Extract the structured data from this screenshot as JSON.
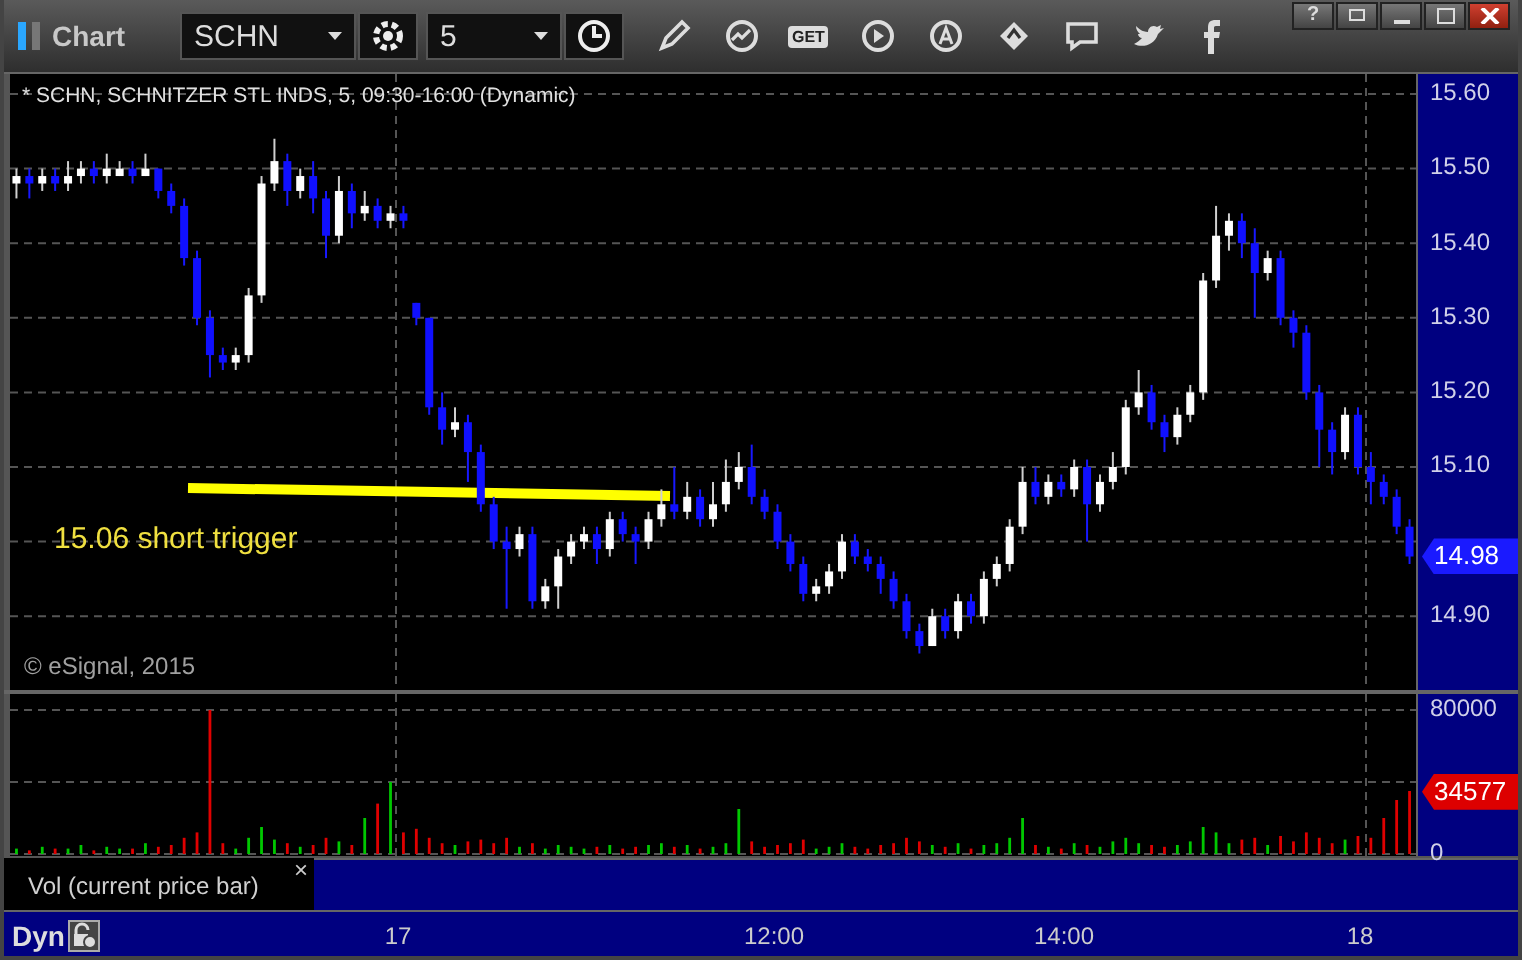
{
  "window": {
    "title": "Chart",
    "help": "?"
  },
  "toolbar": {
    "symbol": "SCHN",
    "interval": "5",
    "get_label": "GET"
  },
  "price_panel": {
    "header": "* SCHN, SCHNITZER STL INDS, 5, 09:30-16:00 (Dynamic)",
    "annotation": "15.06 short trigger",
    "copyright": "© eSignal, 2015",
    "last_price": "14.98",
    "chart_data": {
      "type": "candlestick",
      "yticks": [
        {
          "value": 15.6,
          "label": "15.60"
        },
        {
          "value": 15.5,
          "label": "15.50"
        },
        {
          "value": 15.4,
          "label": "15.40"
        },
        {
          "value": 15.3,
          "label": "15.30"
        },
        {
          "value": 15.2,
          "label": "15.20"
        },
        {
          "value": 15.1,
          "label": "15.10"
        },
        {
          "value": 14.9,
          "label": "14.90"
        }
      ],
      "ylim": [
        14.8,
        15.63
      ],
      "grid": true,
      "ohlc": [
        [
          15.48,
          15.5,
          15.46,
          15.49
        ],
        [
          15.49,
          15.5,
          15.46,
          15.48
        ],
        [
          15.48,
          15.5,
          15.47,
          15.49
        ],
        [
          15.49,
          15.5,
          15.47,
          15.48
        ],
        [
          15.48,
          15.51,
          15.47,
          15.49
        ],
        [
          15.49,
          15.51,
          15.48,
          15.5
        ],
        [
          15.5,
          15.51,
          15.48,
          15.49
        ],
        [
          15.49,
          15.52,
          15.48,
          15.5
        ],
        [
          15.49,
          15.51,
          15.49,
          15.5
        ],
        [
          15.5,
          15.51,
          15.48,
          15.49
        ],
        [
          15.49,
          15.52,
          15.49,
          15.5
        ],
        [
          15.5,
          15.5,
          15.46,
          15.47
        ],
        [
          15.47,
          15.48,
          15.44,
          15.45
        ],
        [
          15.45,
          15.46,
          15.37,
          15.38
        ],
        [
          15.38,
          15.39,
          15.29,
          15.3
        ],
        [
          15.3,
          15.31,
          15.22,
          15.25
        ],
        [
          15.25,
          15.26,
          15.23,
          15.24
        ],
        [
          15.24,
          15.26,
          15.23,
          15.25
        ],
        [
          15.25,
          15.34,
          15.24,
          15.33
        ],
        [
          15.33,
          15.49,
          15.32,
          15.48
        ],
        [
          15.48,
          15.54,
          15.47,
          15.51
        ],
        [
          15.51,
          15.52,
          15.45,
          15.47
        ],
        [
          15.47,
          15.5,
          15.46,
          15.49
        ],
        [
          15.49,
          15.51,
          15.44,
          15.46
        ],
        [
          15.46,
          15.47,
          15.38,
          15.41
        ],
        [
          15.41,
          15.49,
          15.4,
          15.47
        ],
        [
          15.47,
          15.48,
          15.42,
          15.44
        ],
        [
          15.44,
          15.47,
          15.43,
          15.45
        ],
        [
          15.45,
          15.46,
          15.42,
          15.43
        ],
        [
          15.43,
          15.45,
          15.42,
          15.44
        ],
        [
          15.44,
          15.45,
          15.42,
          15.43
        ],
        [
          15.32,
          15.32,
          15.29,
          15.3
        ],
        [
          15.3,
          15.3,
          15.17,
          15.18
        ],
        [
          15.18,
          15.2,
          15.13,
          15.15
        ],
        [
          15.15,
          15.18,
          15.14,
          15.16
        ],
        [
          15.16,
          15.17,
          15.08,
          15.12
        ],
        [
          15.12,
          15.13,
          15.04,
          15.05
        ],
        [
          15.05,
          15.06,
          14.99,
          15.0
        ],
        [
          15.0,
          15.02,
          14.91,
          14.99
        ],
        [
          14.99,
          15.02,
          14.98,
          15.01
        ],
        [
          15.01,
          15.02,
          14.91,
          14.92
        ],
        [
          14.92,
          14.95,
          14.91,
          14.94
        ],
        [
          14.94,
          14.99,
          14.91,
          14.98
        ],
        [
          14.98,
          15.01,
          14.97,
          15.0
        ],
        [
          15.0,
          15.02,
          14.99,
          15.01
        ],
        [
          15.01,
          15.02,
          14.97,
          14.99
        ],
        [
          14.99,
          15.04,
          14.98,
          15.03
        ],
        [
          15.03,
          15.04,
          15.0,
          15.01
        ],
        [
          15.01,
          15.02,
          14.97,
          15.0
        ],
        [
          15.0,
          15.04,
          14.99,
          15.03
        ],
        [
          15.03,
          15.07,
          15.02,
          15.05
        ],
        [
          15.05,
          15.1,
          15.03,
          15.04
        ],
        [
          15.04,
          15.08,
          15.03,
          15.06
        ],
        [
          15.06,
          15.07,
          15.02,
          15.03
        ],
        [
          15.03,
          15.08,
          15.02,
          15.05
        ],
        [
          15.05,
          15.11,
          15.04,
          15.08
        ],
        [
          15.08,
          15.12,
          15.07,
          15.1
        ],
        [
          15.1,
          15.13,
          15.05,
          15.06
        ],
        [
          15.06,
          15.07,
          15.03,
          15.04
        ],
        [
          15.04,
          15.05,
          14.99,
          15.0
        ],
        [
          15.0,
          15.01,
          14.96,
          14.97
        ],
        [
          14.97,
          14.98,
          14.92,
          14.93
        ],
        [
          14.93,
          14.95,
          14.92,
          14.94
        ],
        [
          14.94,
          14.97,
          14.93,
          14.96
        ],
        [
          14.96,
          15.01,
          14.95,
          15.0
        ],
        [
          15.0,
          15.01,
          14.97,
          14.98
        ],
        [
          14.98,
          14.99,
          14.96,
          14.97
        ],
        [
          14.97,
          14.98,
          14.93,
          14.95
        ],
        [
          14.95,
          14.96,
          14.91,
          14.92
        ],
        [
          14.92,
          14.93,
          14.87,
          14.88
        ],
        [
          14.88,
          14.89,
          14.85,
          14.86
        ],
        [
          14.86,
          14.91,
          14.86,
          14.9
        ],
        [
          14.9,
          14.91,
          14.87,
          14.88
        ],
        [
          14.88,
          14.93,
          14.87,
          14.92
        ],
        [
          14.92,
          14.93,
          14.89,
          14.9
        ],
        [
          14.9,
          14.96,
          14.89,
          14.95
        ],
        [
          14.95,
          14.98,
          14.94,
          14.97
        ],
        [
          14.97,
          15.03,
          14.96,
          15.02
        ],
        [
          15.02,
          15.1,
          15.01,
          15.08
        ],
        [
          15.08,
          15.1,
          15.05,
          15.06
        ],
        [
          15.06,
          15.09,
          15.05,
          15.08
        ],
        [
          15.08,
          15.09,
          15.06,
          15.07
        ],
        [
          15.07,
          15.11,
          15.06,
          15.1
        ],
        [
          15.1,
          15.11,
          15.0,
          15.05
        ],
        [
          15.05,
          15.09,
          15.04,
          15.08
        ],
        [
          15.08,
          15.12,
          15.07,
          15.1
        ],
        [
          15.1,
          15.19,
          15.09,
          15.18
        ],
        [
          15.18,
          15.23,
          15.17,
          15.2
        ],
        [
          15.2,
          15.21,
          15.15,
          15.16
        ],
        [
          15.16,
          15.17,
          15.12,
          15.14
        ],
        [
          15.14,
          15.18,
          15.13,
          15.17
        ],
        [
          15.17,
          15.21,
          15.16,
          15.2
        ],
        [
          15.2,
          15.36,
          15.19,
          15.35
        ],
        [
          15.35,
          15.45,
          15.34,
          15.41
        ],
        [
          15.41,
          15.44,
          15.39,
          15.43
        ],
        [
          15.43,
          15.44,
          15.38,
          15.4
        ],
        [
          15.4,
          15.42,
          15.3,
          15.36
        ],
        [
          15.36,
          15.39,
          15.35,
          15.38
        ],
        [
          15.38,
          15.39,
          15.29,
          15.3
        ],
        [
          15.3,
          15.31,
          15.26,
          15.28
        ],
        [
          15.28,
          15.29,
          15.19,
          15.2
        ],
        [
          15.2,
          15.21,
          15.1,
          15.15
        ],
        [
          15.15,
          15.16,
          15.09,
          15.12
        ],
        [
          15.12,
          15.18,
          15.11,
          15.17
        ],
        [
          15.17,
          15.18,
          15.09,
          15.1
        ],
        [
          15.1,
          15.12,
          15.05,
          15.08
        ],
        [
          15.08,
          15.09,
          15.05,
          15.06
        ],
        [
          15.06,
          15.07,
          15.01,
          15.02
        ],
        [
          15.02,
          15.03,
          14.97,
          14.98
        ]
      ]
    }
  },
  "volume_panel": {
    "legend": "Vol (current price bar)",
    "legend_close": "×",
    "last_volume": "34577",
    "chart_data": {
      "type": "bar",
      "yticks": [
        0,
        80000
      ],
      "ylim": [
        0,
        90000
      ],
      "values": [
        3000,
        2000,
        4000,
        3000,
        3000,
        5000,
        2000,
        4000,
        3000,
        3000,
        6000,
        4000,
        5000,
        9000,
        12000,
        80000,
        6000,
        3000,
        9000,
        15000,
        8000,
        6000,
        4000,
        5000,
        9000,
        7000,
        5000,
        20000,
        28000,
        40000,
        12000,
        14000,
        9000,
        6000,
        5000,
        7000,
        8000,
        6000,
        9000,
        4000,
        6000,
        3000,
        5000,
        4000,
        3000,
        4000,
        5000,
        3000,
        4000,
        5000,
        6000,
        4000,
        5000,
        3000,
        4000,
        6000,
        25000,
        7000,
        4000,
        5000,
        6000,
        8000,
        3000,
        4000,
        6000,
        4000,
        3000,
        5000,
        6000,
        9000,
        7000,
        5000,
        4000,
        6000,
        3000,
        5000,
        6000,
        9000,
        20000,
        5000,
        4000,
        3000,
        6000,
        5000,
        4000,
        7000,
        9000,
        6000,
        5000,
        4000,
        5000,
        7000,
        15000,
        12000,
        6000,
        8000,
        9000,
        5000,
        10000,
        7000,
        12000,
        9000,
        6000,
        8000,
        10000,
        9000,
        20000,
        30000,
        35000
      ]
    }
  },
  "time_axis": {
    "mode": "Dyn",
    "labels": [
      "17",
      "12:00",
      "14:00",
      "18"
    ]
  }
}
